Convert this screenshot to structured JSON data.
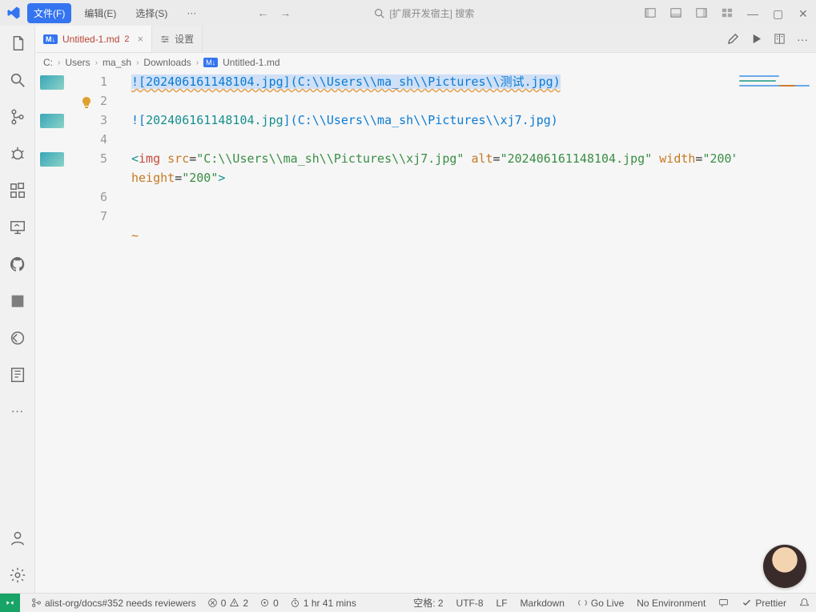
{
  "menu": {
    "file": "文件(F)",
    "edit": "编辑(E)",
    "select": "选择(S)",
    "more": "···"
  },
  "search_placeholder": "[扩展开发宿主] 搜索",
  "tabs": {
    "active": {
      "badge": "M↓",
      "name": "Untitled-1.md",
      "problems": "2"
    },
    "second": {
      "label": "设置"
    }
  },
  "breadcrumb": [
    "C:",
    "Users",
    "ma_sh",
    "Downloads",
    "Untitled-1.md"
  ],
  "breadcrumb_badge": "M↓",
  "code": {
    "l1_text": "![202406161148104.jpg](C:\\\\Users\\\\ma_sh\\\\Pictures\\\\测试.jpg)",
    "l3_prefix": "![",
    "l3_alt": "202406161148104.jpg",
    "l3_mid": "](",
    "l3_path": "C:\\\\Users\\\\ma_sh\\\\Pictures\\\\xj7.jpg",
    "l3_suffix": ")",
    "l5_open": "<",
    "l5_tag": "img",
    "l5_sp1": " ",
    "l5_attr_src": "src",
    "l5_eq": "=",
    "l5_src_val": "\"C:\\\\Users\\\\ma_sh\\\\Pictures\\\\xj7.jpg\"",
    "l5_attr_alt": "alt",
    "l5_alt_val": "\"202406161148104.jpg\"",
    "l5_attr_width": "width",
    "l5_width_val": "\"200\"",
    "l5_attr_height": "height",
    "l5_height_val": "\"200\"",
    "l5_close": ">",
    "tilde": "~"
  },
  "line_numbers": [
    "1",
    "2",
    "3",
    "4",
    "5",
    "6",
    "7"
  ],
  "status": {
    "branch": "alist-org/docs#352 needs reviewers",
    "errors": "0",
    "warnings": "2",
    "ports": "0",
    "time": "1 hr 41 mins",
    "cursor": "空格: 2",
    "encoding": "UTF-8",
    "eol": "LF",
    "language": "Markdown",
    "golive": "Go Live",
    "env": "No Environment",
    "prettier": "Prettier"
  }
}
